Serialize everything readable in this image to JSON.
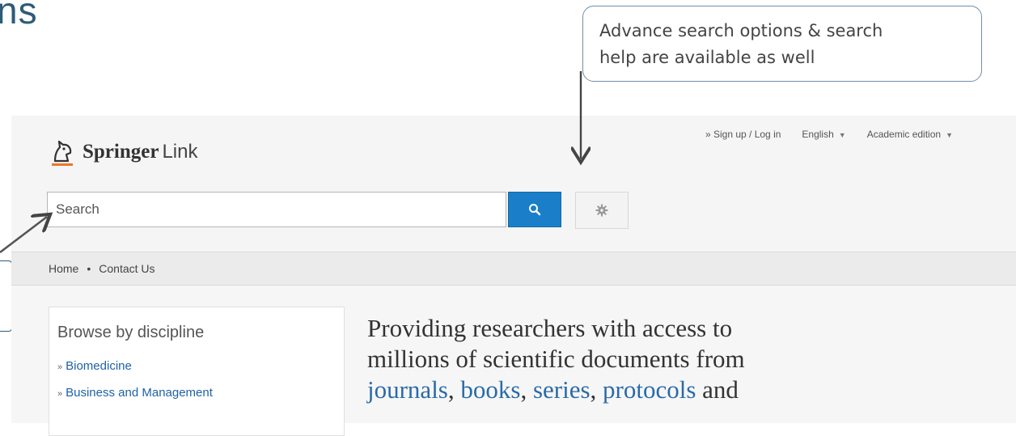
{
  "slide": {
    "title_fragment": "ns",
    "callout_line1": "Advance search options & search",
    "callout_line2": "help are available as well"
  },
  "header": {
    "logo_springer": "Springer",
    "logo_link": "Link",
    "signup": "» Sign up / Log in",
    "language": "English",
    "edition": "Academic edition"
  },
  "search": {
    "placeholder": "Search"
  },
  "nav": {
    "home": "Home",
    "separator": "•",
    "contact": "Contact Us"
  },
  "browse": {
    "heading": "Browse by discipline",
    "items": [
      {
        "label": "Biomedicine"
      },
      {
        "label": "Business and Management"
      }
    ]
  },
  "tagline": {
    "line1": "Providing researchers with access to",
    "line2": "millions of scientific documents from",
    "link1": "journals",
    "sep1": ", ",
    "link2": "books",
    "sep2": ", ",
    "link3": "series",
    "sep3": ", ",
    "link4": "protocols",
    "tail": " and"
  },
  "colors": {
    "accent": "#1a7fc8",
    "slide_blue": "#2e5b78",
    "link": "#1f62a6"
  }
}
